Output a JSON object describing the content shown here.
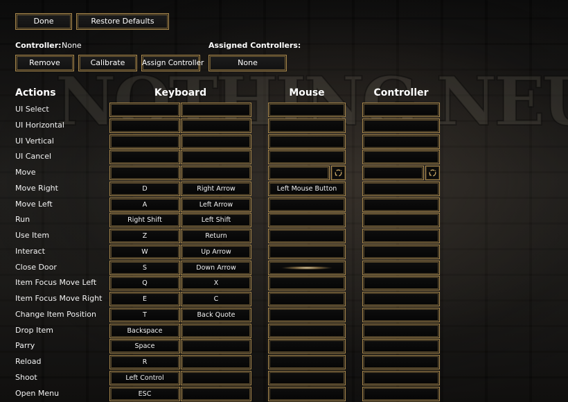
{
  "toolbar": {
    "done": "Done",
    "restore": "Restore Defaults"
  },
  "controller": {
    "label": "Controller:",
    "value": "None",
    "assigned_label": "Assigned Controllers:",
    "assigned_value": "None",
    "remove": "Remove",
    "calibrate": "Calibrate",
    "assign": "Assign Controller"
  },
  "columns": {
    "actions": "Actions",
    "keyboard": "Keyboard",
    "mouse": "Mouse",
    "controller": "Controller"
  },
  "logo_text": "NOTHING NEUSCHE",
  "rows": [
    {
      "action": "UI Select",
      "kb1": "",
      "kb2": "",
      "mouse": "",
      "controller": ""
    },
    {
      "action": "UI Horizontal",
      "kb1": "",
      "kb2": "",
      "mouse": "",
      "controller": ""
    },
    {
      "action": "UI Vertical",
      "kb1": "",
      "kb2": "",
      "mouse": "",
      "controller": ""
    },
    {
      "action": "UI Cancel",
      "kb1": "",
      "kb2": "",
      "mouse": "",
      "controller": ""
    },
    {
      "action": "Move",
      "kb1": "",
      "kb2": "",
      "mouse": "",
      "controller": ""
    },
    {
      "action": "Move Right",
      "kb1": "D",
      "kb2": "Right Arrow",
      "mouse": "Left Mouse Button",
      "controller": ""
    },
    {
      "action": "Move Left",
      "kb1": "A",
      "kb2": "Left Arrow",
      "mouse": "",
      "controller": ""
    },
    {
      "action": "Run",
      "kb1": "Right Shift",
      "kb2": "Left Shift",
      "mouse": "",
      "controller": ""
    },
    {
      "action": "Use Item",
      "kb1": "Z",
      "kb2": "Return",
      "mouse": "",
      "controller": ""
    },
    {
      "action": "Interact",
      "kb1": "W",
      "kb2": "Up Arrow",
      "mouse": "",
      "controller": ""
    },
    {
      "action": "Close Door",
      "kb1": "S",
      "kb2": "Down Arrow",
      "mouse": "",
      "controller": ""
    },
    {
      "action": "Item Focus Move Left",
      "kb1": "Q",
      "kb2": "X",
      "mouse": "",
      "controller": ""
    },
    {
      "action": "Item Focus Move Right",
      "kb1": "E",
      "kb2": "C",
      "mouse": "",
      "controller": ""
    },
    {
      "action": "Change Item Position",
      "kb1": "T",
      "kb2": "Back Quote",
      "mouse": "",
      "controller": ""
    },
    {
      "action": "Drop Item",
      "kb1": "Backspace",
      "kb2": "",
      "mouse": "",
      "controller": ""
    },
    {
      "action": "Parry",
      "kb1": "Space",
      "kb2": "",
      "mouse": "",
      "controller": ""
    },
    {
      "action": "Reload",
      "kb1": "R",
      "kb2": "",
      "mouse": "",
      "controller": ""
    },
    {
      "action": "Shoot",
      "kb1": "Left Control",
      "kb2": "",
      "mouse": "",
      "controller": ""
    },
    {
      "action": "Open Menu",
      "kb1": "ESC",
      "kb2": "",
      "mouse": "",
      "controller": ""
    }
  ],
  "axis_rows": [
    "Move"
  ],
  "glow_rows": [
    "Close Door"
  ],
  "icons": {
    "axis": "axis-rotate-icon"
  },
  "colors": {
    "border_gold": "#a7874c",
    "cell_bg": "#0a0a0a",
    "text": "#ffffff"
  }
}
